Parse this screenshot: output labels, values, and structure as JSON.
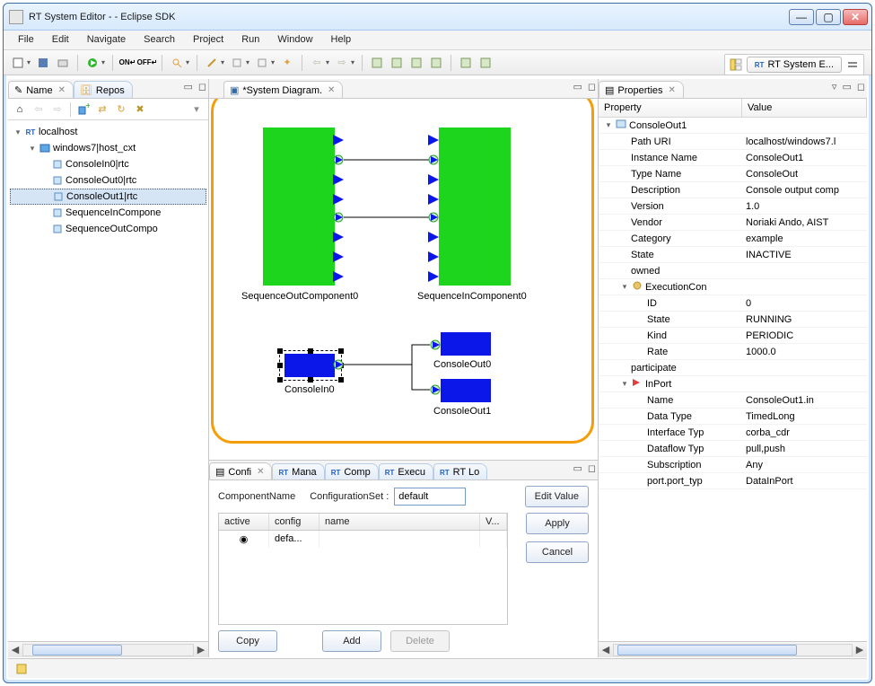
{
  "window": {
    "title": "RT System Editor -  - Eclipse SDK"
  },
  "menu": [
    "File",
    "Edit",
    "Navigate",
    "Search",
    "Project",
    "Run",
    "Window",
    "Help"
  ],
  "perspective": {
    "label": "RT System E..."
  },
  "name_view": {
    "tabs": {
      "active": "Name",
      "inactive": "Repos"
    },
    "tree": {
      "root": "localhost",
      "ctx": "windows7|host_cxt",
      "items": [
        "ConsoleIn0|rtc",
        "ConsoleOut0|rtc",
        "ConsoleOut1|rtc",
        "SequenceInCompone",
        "SequenceOutCompo"
      ],
      "selected_index": 2
    }
  },
  "diagram": {
    "tab": "*System Diagram.",
    "labels": {
      "seq_out": "SequenceOutComponent0",
      "seq_in": "SequenceInComponent0",
      "cin0": "ConsoleIn0",
      "cout0": "ConsoleOut0",
      "cout1": "ConsoleOut1"
    }
  },
  "bottom_tabs": [
    "Confi",
    "Mana",
    "Comp",
    "Execu",
    "RT Lo"
  ],
  "config": {
    "component_label": "ComponentName",
    "configset_label": "ConfigurationSet :",
    "configset_value": "default",
    "buttons": {
      "edit": "Edit Value",
      "apply": "Apply",
      "cancel": "Cancel",
      "copy": "Copy",
      "add": "Add",
      "delete": "Delete"
    },
    "columns": {
      "active": "active",
      "config": "config",
      "name": "name",
      "value": "V..."
    },
    "row": {
      "config": "defa..."
    }
  },
  "properties": {
    "tab": "Properties",
    "header": {
      "property": "Property",
      "value": "Value"
    },
    "rows": [
      {
        "k": "ConsoleOut1",
        "v": "",
        "depth": 0,
        "icon": "comp",
        "twist": "▾"
      },
      {
        "k": "Path URI",
        "v": "localhost/windows7.l",
        "depth": 1
      },
      {
        "k": "Instance Name",
        "v": "ConsoleOut1",
        "depth": 1
      },
      {
        "k": "Type Name",
        "v": "ConsoleOut",
        "depth": 1
      },
      {
        "k": "Description",
        "v": "Console output comp",
        "depth": 1
      },
      {
        "k": "Version",
        "v": "1.0",
        "depth": 1
      },
      {
        "k": "Vendor",
        "v": "Noriaki Ando, AIST",
        "depth": 1
      },
      {
        "k": "Category",
        "v": "example",
        "depth": 1
      },
      {
        "k": "State",
        "v": "INACTIVE",
        "depth": 1
      },
      {
        "k": "owned",
        "v": "",
        "depth": 1
      },
      {
        "k": "ExecutionCon",
        "v": "",
        "depth": 1,
        "icon": "gear",
        "twist": "▾"
      },
      {
        "k": "ID",
        "v": "0",
        "depth": 2
      },
      {
        "k": "State",
        "v": "RUNNING",
        "depth": 2
      },
      {
        "k": "Kind",
        "v": "PERIODIC",
        "depth": 2
      },
      {
        "k": "Rate",
        "v": "1000.0",
        "depth": 2
      },
      {
        "k": "participate",
        "v": "",
        "depth": 1
      },
      {
        "k": "InPort",
        "v": "",
        "depth": 1,
        "icon": "inport",
        "twist": "▾"
      },
      {
        "k": "Name",
        "v": "ConsoleOut1.in",
        "depth": 2
      },
      {
        "k": "Data Type",
        "v": "TimedLong",
        "depth": 2
      },
      {
        "k": "Interface Typ",
        "v": "corba_cdr",
        "depth": 2
      },
      {
        "k": "Dataflow Typ",
        "v": "pull,push",
        "depth": 2
      },
      {
        "k": "Subscription",
        "v": "Any",
        "depth": 2
      },
      {
        "k": "port.port_typ",
        "v": "DataInPort",
        "depth": 2
      }
    ]
  }
}
